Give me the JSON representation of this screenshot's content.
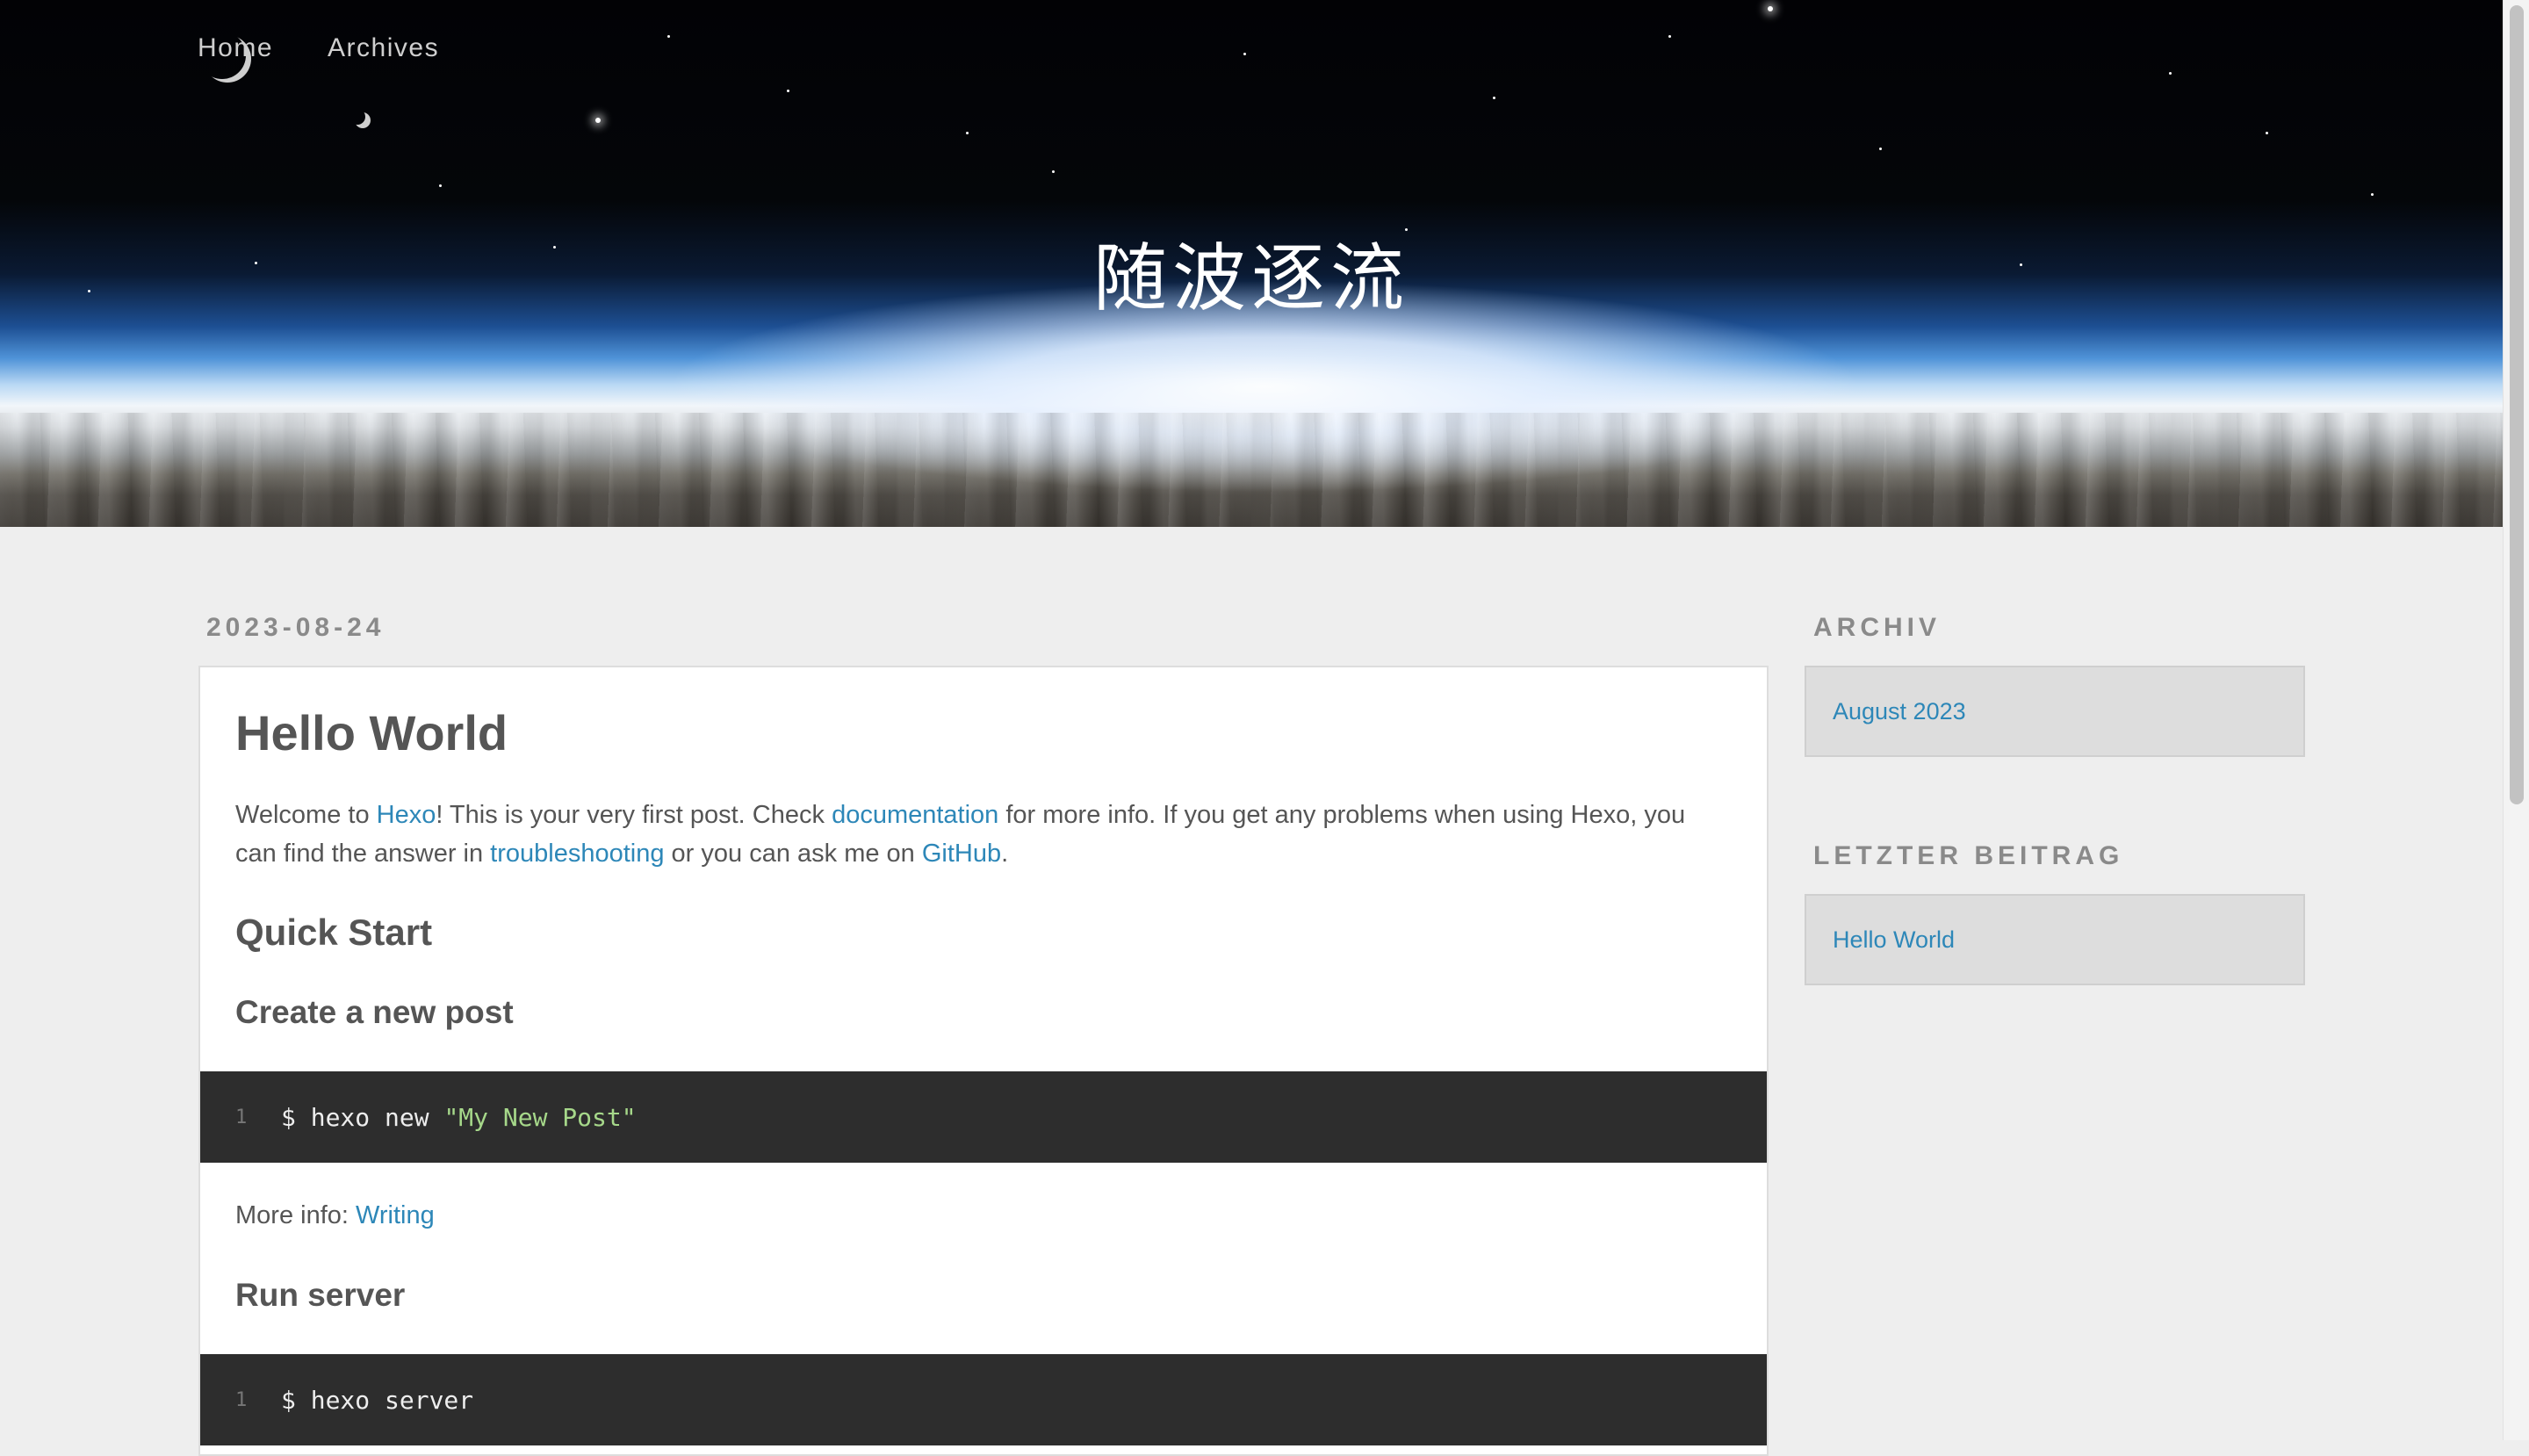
{
  "nav": {
    "items": [
      {
        "label": "Home"
      },
      {
        "label": "Archives"
      }
    ]
  },
  "site": {
    "title": "随波逐流"
  },
  "post": {
    "date": "2023-08-24",
    "title": "Hello World",
    "intro": {
      "t1": "Welcome to ",
      "link1": "Hexo",
      "t2": "! This is your very first post. Check ",
      "link2": "documentation",
      "t3": " for more info. If you get any problems when using Hexo, you can find the answer in ",
      "link3": "troubleshooting",
      "t4": " or you can ask me on ",
      "link4": "GitHub",
      "t5": "."
    },
    "quick_start": "Quick Start",
    "create_post": {
      "heading": "Create a new post",
      "code_line_no": "1",
      "code_cmd": "$ hexo new ",
      "code_str": "\"My New Post\"",
      "more_info_label": "More info: ",
      "more_info_link": "Writing"
    },
    "run_server": {
      "heading": "Run server",
      "code_line_no": "1",
      "code_cmd": "$ hexo server"
    }
  },
  "sidebar": {
    "archive": {
      "heading": "ARCHIV",
      "item": "August 2023"
    },
    "latest": {
      "heading": "LETZTER BEITRAG",
      "item": "Hello World"
    }
  }
}
